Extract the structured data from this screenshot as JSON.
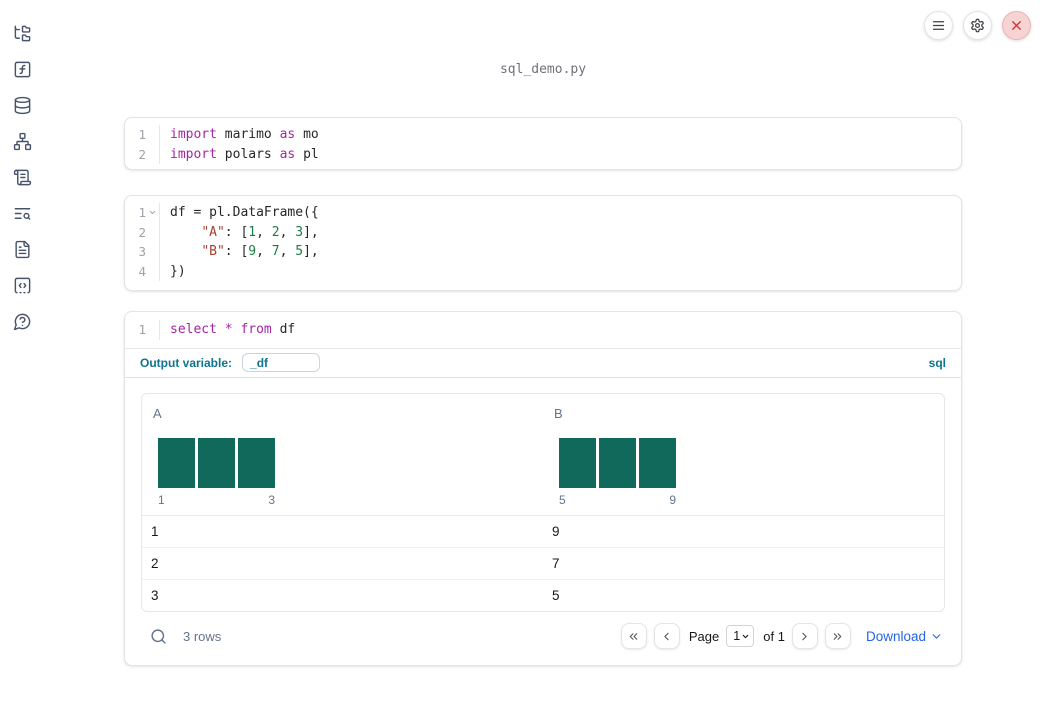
{
  "window": {
    "title": "sql_demo.py"
  },
  "topbar": {
    "buttons": [
      "notebook-menu",
      "settings",
      "shutdown"
    ]
  },
  "sidebar": {
    "items": [
      "file-explorer",
      "variables",
      "data-sources",
      "dependencies",
      "outline",
      "logs",
      "documentation",
      "snippets",
      "help"
    ]
  },
  "colors": {
    "keyword": "#a626a4",
    "string": "#a5402d",
    "number": "#1b7e45",
    "accent": "#0e7490",
    "link": "#2563eb",
    "histogram_bar": "#10695a",
    "close_red": "#dc2626"
  },
  "cells": [
    {
      "name": "imports-cell",
      "lines": [
        {
          "num": "1",
          "tokens": [
            {
              "t": "import",
              "c": "kw"
            },
            {
              "t": " marimo ",
              "c": "pl"
            },
            {
              "t": "as",
              "c": "kw"
            },
            {
              "t": " mo",
              "c": "pl"
            }
          ]
        },
        {
          "num": "2",
          "tokens": [
            {
              "t": "import",
              "c": "kw"
            },
            {
              "t": " polars ",
              "c": "pl"
            },
            {
              "t": "as",
              "c": "kw"
            },
            {
              "t": " pl",
              "c": "pl"
            }
          ]
        }
      ]
    },
    {
      "name": "dataframe-cell",
      "lines": [
        {
          "num": "1",
          "fold": true,
          "tokens": [
            {
              "t": "df = pl.DataFrame({",
              "c": "pl"
            }
          ]
        },
        {
          "num": "2",
          "tokens": [
            {
              "t": "    ",
              "c": "pl"
            },
            {
              "t": "\"A\"",
              "c": "str"
            },
            {
              "t": ": [",
              "c": "pl"
            },
            {
              "t": "1",
              "c": "num"
            },
            {
              "t": ", ",
              "c": "pl"
            },
            {
              "t": "2",
              "c": "num"
            },
            {
              "t": ", ",
              "c": "pl"
            },
            {
              "t": "3",
              "c": "num"
            },
            {
              "t": "],",
              "c": "pl"
            }
          ]
        },
        {
          "num": "3",
          "tokens": [
            {
              "t": "    ",
              "c": "pl"
            },
            {
              "t": "\"B\"",
              "c": "str"
            },
            {
              "t": ": [",
              "c": "pl"
            },
            {
              "t": "9",
              "c": "num"
            },
            {
              "t": ", ",
              "c": "pl"
            },
            {
              "t": "7",
              "c": "num"
            },
            {
              "t": ", ",
              "c": "pl"
            },
            {
              "t": "5",
              "c": "num"
            },
            {
              "t": "],",
              "c": "pl"
            }
          ]
        },
        {
          "num": "4",
          "tokens": [
            {
              "t": "})",
              "c": "pl"
            }
          ]
        }
      ]
    },
    {
      "name": "sql-cell",
      "lines": [
        {
          "num": "1",
          "tokens": [
            {
              "t": "select",
              "c": "kw"
            },
            {
              "t": " ",
              "c": "pl"
            },
            {
              "t": "*",
              "c": "kw"
            },
            {
              "t": " ",
              "c": "pl"
            },
            {
              "t": "from",
              "c": "kw"
            },
            {
              "t": " df",
              "c": "pl"
            }
          ]
        }
      ]
    }
  ],
  "sql_cell": {
    "output_variable_label": "Output variable:",
    "output_variable_value": "_df",
    "language_label": "sql"
  },
  "table": {
    "columns": [
      {
        "name": "A",
        "histogram": {
          "bar_count": 3,
          "min_label": "1",
          "max_label": "3"
        }
      },
      {
        "name": "B",
        "histogram": {
          "bar_count": 3,
          "min_label": "5",
          "max_label": "9"
        }
      }
    ],
    "rows": [
      [
        "1",
        "9"
      ],
      [
        "2",
        "7"
      ],
      [
        "3",
        "5"
      ]
    ],
    "footer": {
      "row_count": "3 rows",
      "page_label": "Page",
      "page_value": "1",
      "of_label": "of 1",
      "download_label": "Download"
    }
  }
}
